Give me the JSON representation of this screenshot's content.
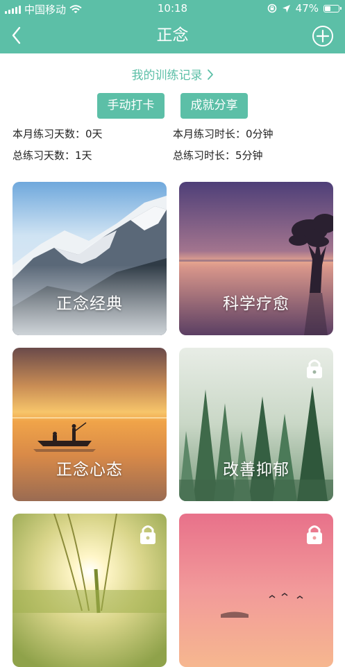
{
  "status_bar": {
    "carrier": "中国移动",
    "time": "10:18",
    "battery": "47%",
    "battery_level": 0.47
  },
  "nav": {
    "title": "正念",
    "back_icon": "chevron-left-icon",
    "add_icon": "plus-circle-icon"
  },
  "record_link": "我的训练记录",
  "buttons": {
    "checkin": "手动打卡",
    "share": "成就分享"
  },
  "stats": {
    "month_days": "本月练习天数：0天",
    "month_time": "本月练习时长：0分钟",
    "total_days": "总练习天数：1天",
    "total_time": "总练习时长：5分钟"
  },
  "cards": [
    {
      "label": "正念经典",
      "locked": false
    },
    {
      "label": "科学疗愈",
      "locked": false
    },
    {
      "label": "正念心态",
      "locked": false
    },
    {
      "label": "改善抑郁",
      "locked": true
    },
    {
      "label": "",
      "locked": true
    },
    {
      "label": "",
      "locked": true
    }
  ],
  "colors": {
    "brand": "#5cbfa7"
  }
}
